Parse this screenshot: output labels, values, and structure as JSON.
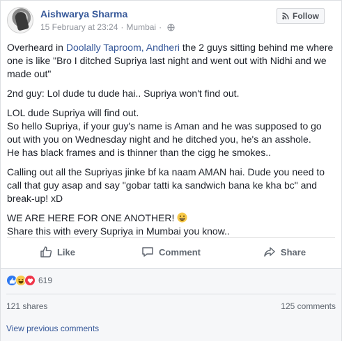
{
  "post": {
    "author": "Aishwarya Sharma",
    "date": "15 February at 23:24",
    "separator": "·",
    "location": "Mumbai",
    "follow_label": "Follow"
  },
  "body": {
    "p1_prefix": "Overheard in ",
    "p1_link": "Doolally Taproom, Andheri",
    "p1_suffix": " the 2 guys sitting behind me where one is like \"Bro I ditched Supriya last night and went out with Nidhi and we made out\"",
    "p2": "2nd guy: Lol dude tu dude hai.. Supriya won't find out.",
    "p3_l1": "LOL dude Supriya will find out.",
    "p3_l2": "So hello Supriya, if your guy's name is Aman and he was supposed to go out with you on Wednesday night and he ditched you, he's an asshole.",
    "p3_l3": "He has black frames and is thinner than the cigg he smokes..",
    "p4": "Calling out all the Supriyas jinke bf ka naam AMAN hai. Dude you need to call that guy asap and say \"gobar tatti ka sandwich bana ke kha bc\" and break-up! xD",
    "p5_l1": "WE ARE HERE FOR ONE ANOTHER! ",
    "p5_l2": "Share this with every Supriya in Mumbai you know.."
  },
  "actions": {
    "like": "Like",
    "comment": "Comment",
    "share": "Share"
  },
  "stats": {
    "reaction_count": "619",
    "shares": "121 shares",
    "comments": "125 comments",
    "view_previous": "View previous comments"
  },
  "colors": {
    "link": "#365899",
    "like_reaction": "#2e78f0",
    "haha_reaction": "#f7c94a",
    "love_reaction": "#f0364a"
  },
  "icons": {
    "privacy": "globe-icon",
    "follow": "rss-icon",
    "like": "thumbs-up-icon",
    "comment": "speech-bubble-icon",
    "share": "share-arrow-icon",
    "emoji": "smiley-icon"
  }
}
